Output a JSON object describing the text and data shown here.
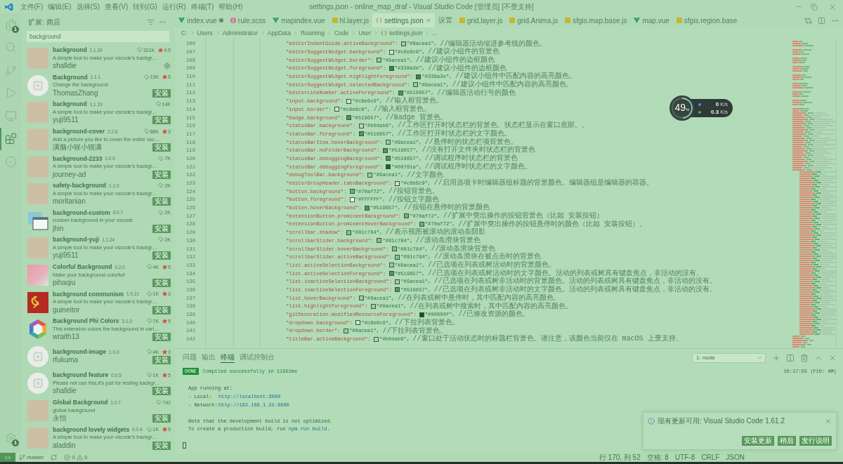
{
  "window": {
    "title": "settings.json - online_map_draf - Visual Studio Code [管理员] [不受支持]",
    "menu": [
      "文件(F)",
      "编辑(E)",
      "选择(S)",
      "查看(V)",
      "转到(G)",
      "运行(R)",
      "终端(T)",
      "帮助(H)"
    ]
  },
  "activity_bar": {
    "items": [
      {
        "kind": "files",
        "selected": false,
        "badge": "1"
      },
      {
        "kind": "search",
        "selected": false
      },
      {
        "kind": "source-control",
        "selected": false
      },
      {
        "kind": "run",
        "selected": false
      },
      {
        "kind": "remote",
        "selected": false
      },
      {
        "kind": "extensions",
        "selected": true
      },
      {
        "kind": "timeline",
        "selected": false
      }
    ],
    "settings_badge": "1"
  },
  "sidebar": {
    "title": "扩展: 商店",
    "search": {
      "value": "background"
    },
    "extensions": [
      {
        "name": "background",
        "version": "1.1.29",
        "downloads": "321K",
        "rating": "4.5",
        "description": "A simple tool to make your vscode's backgr…",
        "publisher": "shalldie",
        "kind": "picture",
        "installed": true
      },
      {
        "name": "Background",
        "version": "1.1.1",
        "downloads": "13K",
        "rating": "5",
        "description": "Change the background",
        "publisher": "ThomasZhang",
        "kind": "default",
        "installed": false,
        "install": "安装"
      },
      {
        "name": "background",
        "version": "1.1.19",
        "downloads": "14K",
        "description": "A simple tool to make your vscode's backgr…",
        "publisher": "yuji9511",
        "kind": "picture",
        "installed": false,
        "install": "安装"
      },
      {
        "name": "background-cover",
        "version": "2.2.6",
        "downloads": "88K",
        "rating": "3",
        "description": "Add a picture you like to cover the entire vsc…",
        "publisher": "满脑小猩小猫满",
        "kind": "picture",
        "installed": false,
        "install": "安装"
      },
      {
        "name": "background-2233",
        "version": "1.0.0",
        "downloads": "7K",
        "description": "A simple tool to make your vscode's backgr…",
        "publisher": "journey-ad",
        "kind": "picture",
        "installed": false,
        "install": "安装"
      },
      {
        "name": "safety-background",
        "version": "1.1.0",
        "downloads": "2K",
        "description": "A simple tool to make your vscode's backgr…",
        "publisher": "moritanian",
        "kind": "picture",
        "installed": false,
        "install": "安装"
      },
      {
        "name": "background-custom",
        "version": "0.0.7",
        "downloads": "2K",
        "description": "custom background in your vscode",
        "publisher": "jhin",
        "kind": "window",
        "installed": false,
        "install": "安装"
      },
      {
        "name": "background-yuji",
        "version": "1.1.24",
        "downloads": "2K",
        "description": "A simple tool to make your vscode's backgr…",
        "publisher": "yuji9511",
        "kind": "picture",
        "installed": false,
        "install": "安装"
      },
      {
        "name": "Colorful Background",
        "version": "0.2.0",
        "downloads": "4K",
        "rating": "5",
        "description": "Make your background colorful!",
        "publisher": "pihaqiu",
        "kind": "gradient",
        "installed": false,
        "install": "安装"
      },
      {
        "name": "background communism",
        "version": "1.0.21",
        "downloads": "1K",
        "rating": "3",
        "description": "A simple tool to make your vscode's backgr…",
        "publisher": "guineitor",
        "kind": "flag",
        "installed": false,
        "install": "安装"
      },
      {
        "name": "Background Phi Colors",
        "version": "3.1.0",
        "downloads": "7K",
        "rating": "5",
        "description": "This extension colors the background in vari…",
        "publisher": "wraith13",
        "kind": "hexagon",
        "installed": false,
        "install": "安装"
      },
      {
        "name": "background-image",
        "version": "1.0.0",
        "downloads": "4K",
        "rating": "3",
        "publisher": "rfukuma",
        "kind": "default",
        "installed": false,
        "install": "安装"
      },
      {
        "name": "background feature",
        "version": "0.0.5",
        "downloads": "1K",
        "rating": "5",
        "description": "Please not use this,it's just for testing backgr…",
        "publisher": "shalldie",
        "kind": "default",
        "installed": false,
        "install": "安装"
      },
      {
        "name": "Global Background",
        "version": "1.0.7",
        "downloads": "742",
        "description": "global background",
        "publisher": "永恒",
        "kind": "picture",
        "installed": false,
        "install": "安装"
      },
      {
        "name": "background lovely widgets",
        "version": "0.0.4",
        "downloads": "1K",
        "rating": "5",
        "description": "A simple tool to make your vscode's backgr…",
        "publisher": "aladdin",
        "kind": "picture",
        "installed": false,
        "install": "安装"
      }
    ]
  },
  "tabs": [
    {
      "label": "index.vue",
      "kind": "vue",
      "selected": false,
      "modified": true
    },
    {
      "label": "rule.scss",
      "kind": "scss",
      "selected": false,
      "modified": false
    },
    {
      "label": "mapindex.vue",
      "kind": "vue",
      "selected": false,
      "modified": false
    },
    {
      "label": "hl.layer.js",
      "kind": "js",
      "selected": false,
      "modified": false
    },
    {
      "label": "settings.json",
      "kind": "json",
      "selected": true,
      "modified": false
    },
    {
      "label": "设置",
      "kind": "plain",
      "selected": false,
      "modified": false
    },
    {
      "label": "grid.layer.js",
      "kind": "js",
      "selected": false,
      "modified": false
    },
    {
      "label": "grid.Anima.js",
      "kind": "js",
      "selected": false,
      "modified": false
    },
    {
      "label": "sfgis.map.base.js",
      "kind": "js",
      "selected": false,
      "modified": false
    },
    {
      "label": "map.vue",
      "kind": "vue",
      "selected": false,
      "modified": false
    },
    {
      "label": "sfgis.region.base",
      "kind": "js",
      "selected": false,
      "modified": false
    }
  ],
  "breadcrumb": [
    {
      "label": "C:",
      "kind": "plain"
    },
    {
      "label": "Users",
      "kind": "plain"
    },
    {
      "label": "Administrator",
      "kind": "plain"
    },
    {
      "label": "AppData",
      "kind": "plain"
    },
    {
      "label": "Roaming",
      "kind": "plain"
    },
    {
      "label": "Code",
      "kind": "plain"
    },
    {
      "label": "User",
      "kind": "plain"
    },
    {
      "label": "settings.json",
      "kind": "json"
    },
    {
      "label": "...",
      "kind": "plain"
    }
  ],
  "editor": {
    "lines": [
      {
        "number": "106",
        "key": "\"editorIndentGuide.activeBackground\":",
        "value": "\"#9acea1\",",
        "comment": "//编辑器活动缩进参考线的颜色。",
        "color": "#9acea1"
      },
      {
        "number": "107",
        "key": "\"editorSuggestWidget.background\":",
        "value": "\"#c8e6c9\",",
        "comment": "//建议小组件的背景色",
        "color": "#c8e6c9"
      },
      {
        "number": "108",
        "key": "\"editorSuggestWidget.border\":",
        "value": "\"#9acea1\",",
        "comment": "//建议小组件的边框颜色",
        "color": "#9acea1"
      },
      {
        "number": "109",
        "key": "\"editorSuggestWidget.foreground\":",
        "value": "\"#338a3e\",",
        "comment": "//建议小组件的边框颜色",
        "color": "#338a3e"
      },
      {
        "number": "110",
        "key": "\"editorSuggestWidget.highlightForeground\":",
        "value": "\"#338a3e\",",
        "comment": "//建议小组件中匹配内容的高亮颜色。",
        "color": "#338a3e"
      },
      {
        "number": "111",
        "key": "\"editorSuggestWidget.selectedBackground\":",
        "value": "\"#9acea1\",",
        "comment": "//建议小组件中匹配内容的高亮颜色。",
        "color": "#9acea1"
      },
      {
        "number": "112",
        "key": "\"editorLineNumber.activeForeground\":",
        "value": "\"#519657\",",
        "comment": "//编辑器活动行号的颜色",
        "color": "#519657"
      },
      {
        "number": "113",
        "key": "\"input.background\":",
        "value": "\"#c8e6c9\",",
        "comment": "//输入框背景色。",
        "color": "#c8e6c9"
      },
      {
        "number": "114",
        "key": "\"input.border\":",
        "value": "\"#c8e6c9\",",
        "comment": "//输入框背景色。",
        "color": "#c8e6c9"
      },
      {
        "number": "115",
        "key": "\"badge.background\":",
        "value": "\"#519657\",",
        "comment": "//Badge 背景色。",
        "color": "#519657"
      },
      {
        "number": "116",
        "key": "\"statusBar.background\":",
        "value": "\"#b0dab6\",",
        "comment": "//工作区打开时状态栏的背景色。状态栏显示在窗口底部。。",
        "color": "#b0dab6"
      },
      {
        "number": "117",
        "key": "\"statusBar.foreground\":",
        "value": "\"#519657\",",
        "comment": "//工作区打开时状态栏的文字颜色。",
        "color": "#519657"
      },
      {
        "number": "118",
        "key": "\"statusBarItem.hoverBackground\":",
        "value": "\"#9acea1\",",
        "comment": "//悬停时的状态栏项背景色。",
        "color": "#9acea1"
      },
      {
        "number": "119",
        "key": "\"statusBar.noFolderBackground\":",
        "value": "\"#519657\",",
        "comment": "//没有打开文件夹时状态栏的背景色",
        "color": "#519657"
      },
      {
        "number": "120",
        "key": "\"statusBar.debuggingBackground\":",
        "value": "\"#519657\",",
        "comment": "//调试程序时状态栏的背景色",
        "color": "#519657"
      },
      {
        "number": "121",
        "key": "\"statusBar.debuggingForeground\":",
        "value": "\"#00701a\",",
        "comment": "//调试程序时状态栏的文字颜色。",
        "color": "#00701a"
      },
      {
        "number": "122",
        "key": "\"debugToolBar.background\":",
        "value": "\"#9acea1\",",
        "comment": "//文字颜色",
        "color": "#9acea1"
      },
      {
        "number": "123",
        "key": "\"editorGroupHeader.tabsBackground\":",
        "value": "\"#c8e6c9\",",
        "comment": "//启用选项卡时编辑器组标题的背景颜色。编辑器组是编辑器的容器。",
        "color": "#c8e6c9"
      },
      {
        "number": "124",
        "key": "\"button.background\":",
        "value": "\"#70af72\",",
        "comment": "//按钮背景色。",
        "color": "#70af72"
      },
      {
        "number": "125",
        "key": "\"button.foreground\":",
        "value": "\"#FFFFFF\",",
        "comment": "//按钮文字颜色",
        "color": "#ffffff"
      },
      {
        "number": "126",
        "key": "\"button.hoverBackground\":",
        "value": "\"#519657\",",
        "comment": "//按钮在悬停时的背景颜色",
        "color": "#519657"
      },
      {
        "number": "127",
        "key": "\"extensionButton.prominentBackground\":",
        "value": "\"#70af72\",",
        "comment": "//扩展中突出操作的按钮背景色（比如 安装按钮）",
        "color": "#70af72"
      },
      {
        "number": "128",
        "key": "\"extensionButton.prominentHoverBackground\":",
        "value": "\"#70af72\",",
        "comment": "//扩展中突出操作的按钮悬停时的颜色（比如 安装按钮）。",
        "color": "#70af72"
      },
      {
        "number": "129",
        "key": "\"scrollbar.shadow\":",
        "value": "\"#81c784\",",
        "comment": "//表示视图被滚动的滚动条阴影",
        "color": "#81c784"
      },
      {
        "number": "130",
        "key": "\"scrollbarSlider.background\":",
        "value": "\"#81c784\",",
        "comment": "//滚动条滑块背景色",
        "color": "#81c784"
      },
      {
        "number": "131",
        "key": "\"scrollbarSlider.hoverBackground\":",
        "value": "\"#81c784\",",
        "comment": "//滚动条滑块背景色",
        "color": "#81c784"
      },
      {
        "number": "132",
        "key": "\"scrollbarSlider.activeBackground\":",
        "value": "\"#81c784\",",
        "comment": "//滚动条滑块在被点击时的背景色",
        "color": "#81c784"
      },
      {
        "number": "133",
        "key": "\"list.activeSelectionBackground\":",
        "value": "\"#9acea1\",",
        "comment": "//已选项在列表或树活动时的背景颜色。",
        "color": "#9acea1"
      },
      {
        "number": "134",
        "key": "\"list.activeSelectionForeground\":",
        "value": "\"#519657\",",
        "comment": "//已选项在列表或树活动时的文字颜色。活动的列表或树具有键盘焦点，非活动的没有。",
        "color": "#519657"
      },
      {
        "number": "135",
        "key": "\"list.inactiveSelectionBackground\":",
        "value": "\"#9acea1\",",
        "comment": "//已选项在列表或树非活动时的背景颜色。活动的列表或树具有键盘焦点，非活动的没有。",
        "color": "#9acea1"
      },
      {
        "number": "136",
        "key": "\"list.inactiveSelectionForeground\":",
        "value": "\"#519657\",",
        "comment": "//已选项在列表或树非活动时的文字颜色。活动的列表或树具有键盘焦点，非活动的没有。",
        "color": "#519657"
      },
      {
        "number": "137",
        "key": "\"list.hoverBackground\":",
        "value": "\"#9acea1\",",
        "comment": "//在列表或树中悬停时，其中匹配内容的高亮颜色。",
        "color": "#9acea1"
      },
      {
        "number": "138",
        "key": "\"list.highlightForeground\":",
        "value": "\"#9acea1\",",
        "comment": "//在列表或树中搜索时，其中匹配内容的高亮颜色。",
        "color": "#9acea1"
      },
      {
        "number": "139",
        "key": "\"gitDecoration.modifiedResourceForeground\":",
        "value": "\"#00600f\",",
        "comment": "//已修改资源的颜色。",
        "color": "#00600f"
      },
      {
        "number": "140",
        "key": "\"dropdown.background\":",
        "value": "\"#c8e6c9\",",
        "comment": "//下拉列表背景色。",
        "color": "#c8e6c9"
      },
      {
        "number": "141",
        "key": "\"dropdown.border\":",
        "value": "\"#9acea1\",",
        "comment": "//下拉列表背景色。",
        "color": "#9acea1"
      },
      {
        "number": "142",
        "key": "\"titleBar.activeBackground\":",
        "value": "\"#b0dab6\",",
        "comment": "//窗口处于活动状态时的标题栏背景色。请注意，该颜色当前仅在 macOS 上受支持。",
        "color": "#b0dab6"
      }
    ]
  },
  "speed_widget": {
    "load": "49",
    "unit": "%",
    "level": 0.49,
    "rates": [
      {
        "value": "0",
        "unit": "K/s",
        "color": "#3f8fe0"
      },
      {
        "value": "0.3",
        "unit": "K/s",
        "color": "#4caf50"
      }
    ]
  },
  "panel": {
    "tabs": [
      {
        "label": "问题",
        "selected": false
      },
      {
        "label": "输出",
        "selected": false
      },
      {
        "label": "终端",
        "selected": true
      },
      {
        "label": "调试控制台",
        "selected": false
      }
    ],
    "terminal_select": "1: node",
    "terminal": [
      {
        "kind": "status",
        "badge": "DONE",
        "text": "Compiled successfully in 11951ms",
        "aside": "10:17:55 |F10: AM|"
      },
      {
        "kind": "blank"
      },
      {
        "kind": "text",
        "parts": [
          {
            "text": "App running at:"
          }
        ]
      },
      {
        "kind": "link",
        "label": "- Local:",
        "link": "http://localhost:8080"
      },
      {
        "kind": "link",
        "label": "- Network:",
        "link": "http://192.168.1.21:8080"
      },
      {
        "kind": "blank"
      },
      {
        "kind": "text",
        "parts": [
          {
            "text": "Note that the development build is not optimized."
          }
        ]
      },
      {
        "kind": "text",
        "parts": [
          {
            "text": "To create a production build, run "
          },
          {
            "text": "npm run build",
            "kind": "command"
          },
          {
            "text": "."
          }
        ]
      },
      {
        "kind": "blank"
      },
      {
        "kind": "cursor"
      }
    ]
  },
  "notification": {
    "message": "现有更新可用: Visual Studio Code 1.61.2",
    "buttons": [
      "安装更新",
      "稍后",
      "发行说明"
    ]
  },
  "status_bar": {
    "branch": "master",
    "errors": "0",
    "warnings": "0",
    "right": [
      "行 170, 列 52",
      "空格: 8",
      "UTF-8",
      "CRLF",
      "JSON"
    ]
  }
}
